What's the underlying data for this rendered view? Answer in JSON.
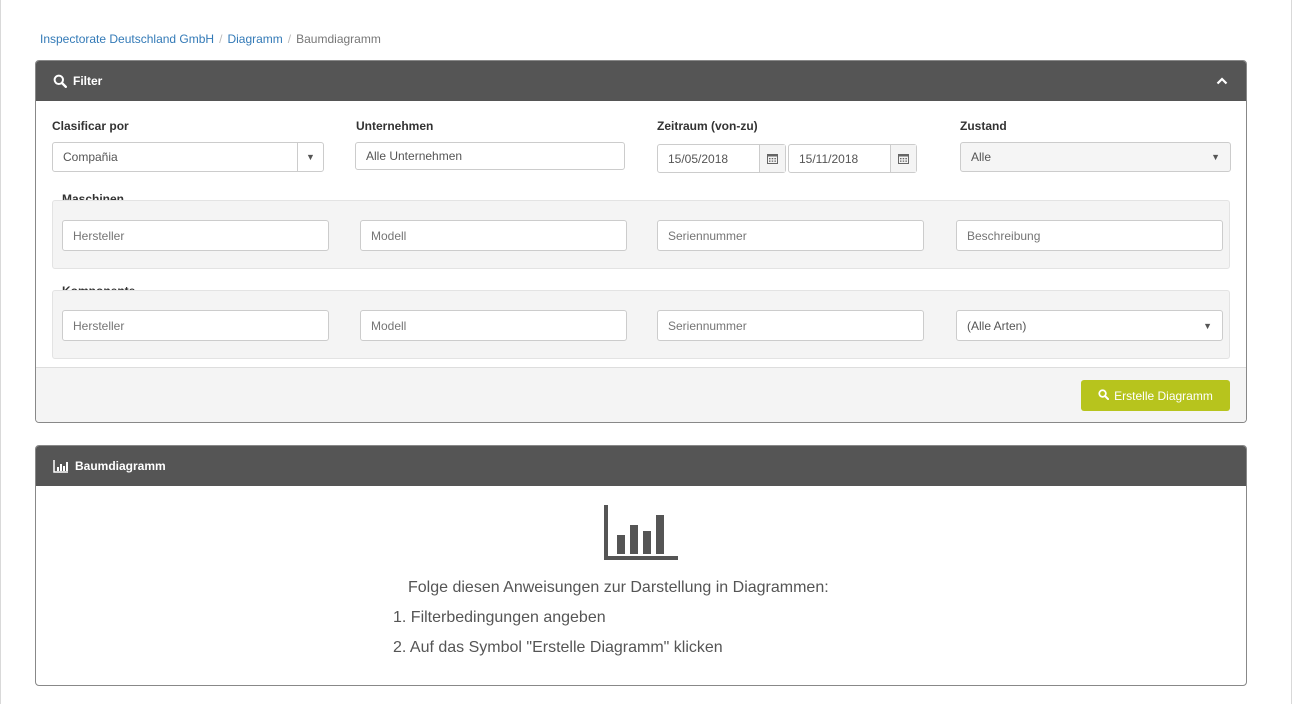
{
  "breadcrumb": {
    "items": [
      "Inspectorate Deutschland GmbH",
      "Diagramm"
    ],
    "current": "Baumdiagramm",
    "separator": "/"
  },
  "filter": {
    "title": "Filter",
    "classify": {
      "label": "Clasificar por",
      "value": "Compañia"
    },
    "company": {
      "label": "Unternehmen",
      "value": "Alle Unternehmen"
    },
    "period": {
      "label": "Zeitraum (von-zu)",
      "from": "15/05/2018",
      "to": "15/11/2018"
    },
    "state": {
      "label": "Zustand",
      "value": "Alle"
    },
    "machines": {
      "legend": "Maschinen",
      "manufacturer_placeholder": "Hersteller",
      "model_placeholder": "Modell",
      "serial_placeholder": "Seriennummer",
      "description_placeholder": "Beschreibung"
    },
    "component": {
      "legend": "Komponente",
      "manufacturer_placeholder": "Hersteller",
      "model_placeholder": "Modell",
      "serial_placeholder": "Seriennummer",
      "type_value": "(Alle Arten)"
    },
    "create_button": "Erstelle Diagramm"
  },
  "chart_panel": {
    "title": "Baumdiagramm",
    "instructions_intro": "Folge diesen Anweisungen zur Darstellung in Diagrammen:",
    "step1": "1. Filterbedingungen angeben",
    "step2": "2. Auf das Symbol \"Erstelle Diagramm\" klicken"
  },
  "colors": {
    "link": "#337ab7",
    "panel_header": "#555555",
    "accent_button": "#b7c41d"
  },
  "icons": [
    "search-icon",
    "chevron-up-icon",
    "calendar-icon",
    "caret-down-icon",
    "bar-chart-icon"
  ]
}
